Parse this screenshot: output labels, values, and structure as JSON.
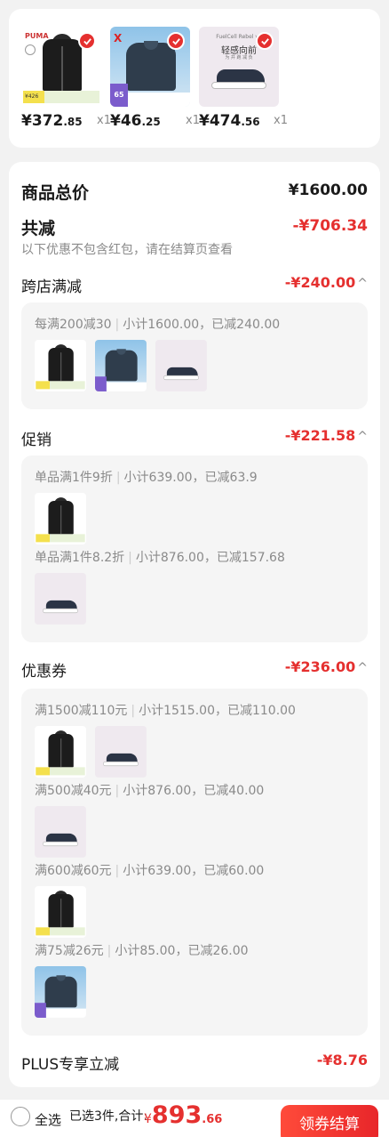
{
  "products": [
    {
      "name": "jacket",
      "price_int": "¥372",
      "price_dec": ".85",
      "qty": "x1",
      "tag_text": "¥426",
      "logo": "PUMA"
    },
    {
      "name": "polo",
      "price_int": "¥46",
      "price_dec": ".25",
      "qty": "x1",
      "tag_num": "65",
      "logo": "X"
    },
    {
      "name": "shoe",
      "price_int": "¥474",
      "price_dec": ".56",
      "qty": "x1",
      "line1": "FuelCell Rebel v4",
      "line2": "轻感向前",
      "line3": "为 并 跑 减 负"
    }
  ],
  "summary": {
    "total_label": "商品总价",
    "total_value": "¥1600.00",
    "reduce_label": "共减",
    "reduce_value": "-¥706.34",
    "note": "以下优惠不包含红包，请在结算页查看"
  },
  "sections": {
    "cross_store": {
      "title": "跨店满减",
      "amount": "-¥240.00",
      "chev": "^",
      "rules": [
        {
          "name": "每满200减30",
          "detail": "小计1600.00，已减240.00"
        }
      ]
    },
    "promo": {
      "title": "促销",
      "amount": "-¥221.58",
      "chev": "^",
      "rules": [
        {
          "name": "单品满1件9折",
          "detail": "小计639.00，已减63.9"
        },
        {
          "name": "单品满1件8.2折",
          "detail": "小计876.00，已减157.68"
        }
      ]
    },
    "coupon": {
      "title": "优惠券",
      "amount": "-¥236.00",
      "chev": "^",
      "rules": [
        {
          "name": "满1500减110元",
          "detail": "小计1515.00，已减110.00"
        },
        {
          "name": "满500减40元",
          "detail": "小计876.00，已减40.00"
        },
        {
          "name": "满600减60元",
          "detail": "小计639.00，已减60.00"
        },
        {
          "name": "满75减26元",
          "detail": "小计85.00，已减26.00"
        }
      ]
    },
    "plus": {
      "title": "PLUS专享立减",
      "amount": "-¥8.76"
    }
  },
  "bottom": {
    "select_all": "全选",
    "summary_text": "已选3件,合计:",
    "currency": "¥",
    "total_int": "893",
    "total_dec": ".66",
    "checkout": "领券结算"
  },
  "colors": {
    "accent": "#e5302f",
    "bg": "#f2f2f2"
  },
  "icons": [
    "check-icon",
    "chevron-up-icon",
    "radio-icon"
  ]
}
